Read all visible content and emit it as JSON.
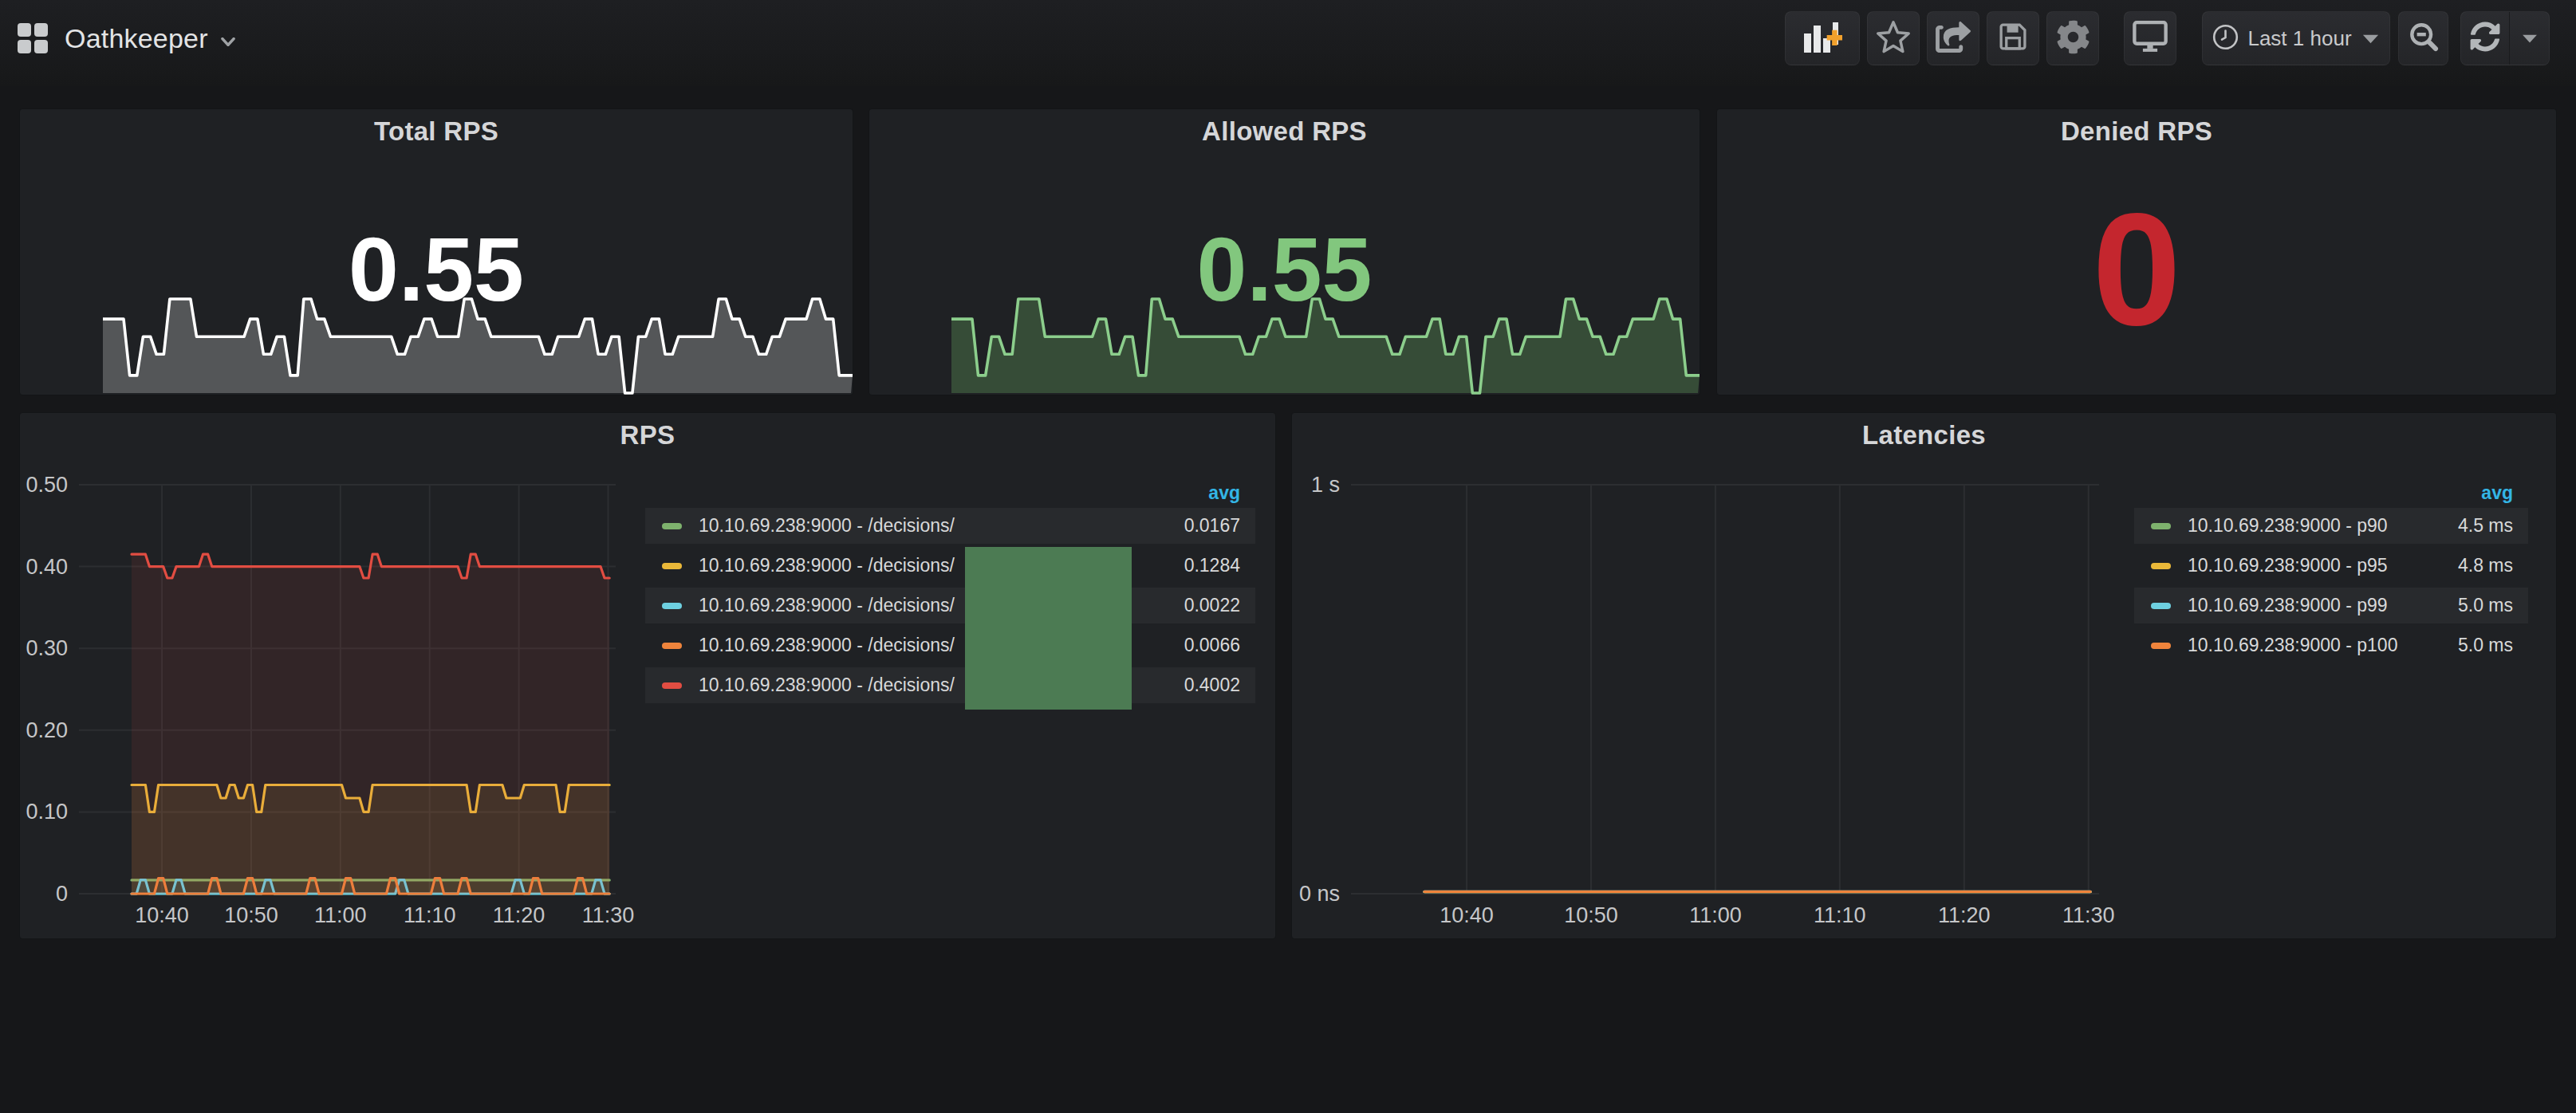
{
  "navbar": {
    "dashboard_title": "Oathkeeper",
    "buttons": {
      "add_panel": "Add panel",
      "star": "Mark as favorite",
      "share": "Share dashboard",
      "save": "Save dashboard",
      "settings": "Dashboard settings",
      "tv_mode": "Cycle view mode",
      "time_range": "Last 1 hour",
      "zoom_out": "Zoom out time range",
      "refresh": "Refresh dashboard"
    }
  },
  "colors": {
    "page_bg": "#161719",
    "panel_bg": "#1f2124",
    "green": "#7EB26D",
    "yellow": "#EAB839",
    "cyan": "#6ED0E0",
    "orange": "#EF843C",
    "red": "#E24D42",
    "stat_white": "#ffffff",
    "stat_green": "#82c77e",
    "stat_red": "#c4262e",
    "legend_header_blue": "#33b5e5",
    "grid_line": "#303236",
    "tick_text": "#c5c6c8",
    "artifact_green": "#4c7b53"
  },
  "panels": {
    "total_rps": {
      "title": "Total RPS",
      "value": "0.55"
    },
    "allowed_rps": {
      "title": "Allowed RPS",
      "value": "0.55"
    },
    "denied_rps": {
      "title": "Denied RPS",
      "value": "0"
    },
    "rps": {
      "title": "RPS",
      "legend_header": "avg",
      "legend": {
        "rows": [
          {
            "label": "10.10.69.238:9000 - /decisions/",
            "avg": "0.0167"
          },
          {
            "label": "10.10.69.238:9000 - /decisions/",
            "avg": "0.1284"
          },
          {
            "label": "10.10.69.238:9000 - /decisions/",
            "avg": "0.0022"
          },
          {
            "label": "10.10.69.238:9000 - /decisions/",
            "avg": "0.0066"
          },
          {
            "label": "10.10.69.238:9000 - /decisions/",
            "avg": "0.4002"
          }
        ]
      }
    },
    "latencies": {
      "title": "Latencies",
      "legend_header": "avg",
      "legend": {
        "rows": [
          {
            "label": "10.10.69.238:9000 - p90",
            "avg": "4.5 ms"
          },
          {
            "label": "10.10.69.238:9000 - p95",
            "avg": "4.8 ms"
          },
          {
            "label": "10.10.69.238:9000 - p99",
            "avg": "5.0 ms"
          },
          {
            "label": "10.10.69.238:9000 - p100",
            "avg": "5.0 ms"
          }
        ]
      }
    }
  },
  "chart_data": [
    {
      "id": "total_rps_sparkline",
      "type": "area",
      "title": "Total RPS",
      "current_value": 0.55,
      "note": "singlestat sparkline, last ~56 minutes, min-max scaled",
      "line_color": "#ffffff",
      "fill_color": "rgba(255,255,255,0.24)",
      "values": [
        0.565,
        0.565,
        0.517,
        0.55,
        0.535,
        0.582,
        0.582,
        0.55,
        0.55,
        0.55,
        0.55,
        0.565,
        0.535,
        0.55,
        0.517,
        0.582,
        0.565,
        0.55,
        0.55,
        0.55,
        0.55,
        0.55,
        0.535,
        0.55,
        0.565,
        0.55,
        0.55,
        0.582,
        0.565,
        0.55,
        0.55,
        0.55,
        0.55,
        0.535,
        0.55,
        0.55,
        0.565,
        0.535,
        0.55,
        0.502,
        0.55,
        0.565,
        0.535,
        0.55,
        0.55,
        0.55,
        0.582,
        0.565,
        0.55,
        0.535,
        0.55,
        0.565,
        0.565,
        0.582,
        0.565,
        0.517
      ]
    },
    {
      "id": "allowed_rps_sparkline",
      "type": "area",
      "title": "Allowed RPS",
      "current_value": 0.55,
      "note": "singlestat sparkline, identical shape to Total RPS",
      "line_color": "#8cce8c",
      "fill_color": "rgba(115,191,105,0.28)",
      "values": [
        0.565,
        0.565,
        0.517,
        0.55,
        0.535,
        0.582,
        0.582,
        0.55,
        0.55,
        0.55,
        0.55,
        0.565,
        0.535,
        0.55,
        0.517,
        0.582,
        0.565,
        0.55,
        0.55,
        0.55,
        0.55,
        0.55,
        0.535,
        0.55,
        0.565,
        0.55,
        0.55,
        0.582,
        0.565,
        0.55,
        0.55,
        0.55,
        0.55,
        0.535,
        0.55,
        0.55,
        0.565,
        0.535,
        0.55,
        0.502,
        0.55,
        0.565,
        0.535,
        0.55,
        0.55,
        0.55,
        0.582,
        0.565,
        0.55,
        0.535,
        0.55,
        0.565,
        0.565,
        0.582,
        0.565,
        0.517
      ]
    },
    {
      "id": "denied_rps",
      "type": "stat",
      "title": "Denied RPS",
      "current_value": 0
    },
    {
      "id": "rps",
      "type": "line",
      "title": "RPS",
      "xlabel": "",
      "ylabel": "",
      "ylim": [
        0,
        0.5
      ],
      "y_ticks": [
        {
          "v": 0.5,
          "label": "0.50"
        },
        {
          "v": 0.4,
          "label": "0.40"
        },
        {
          "v": 0.3,
          "label": "0.30"
        },
        {
          "v": 0.2,
          "label": "0.20"
        },
        {
          "v": 0.1,
          "label": "0.10"
        },
        {
          "v": 0.0,
          "label": "0"
        }
      ],
      "x_ticks": [
        {
          "min": 9.3,
          "label": "10:40"
        },
        {
          "min": 19.3,
          "label": "10:50"
        },
        {
          "min": 29.3,
          "label": "11:00"
        },
        {
          "min": 39.3,
          "label": "11:10"
        },
        {
          "min": 49.3,
          "label": "11:20"
        },
        {
          "min": 59.3,
          "label": "11:30"
        }
      ],
      "x_domain_min": [
        0,
        60.15
      ],
      "data_start_min": 5.9,
      "step_min": 1,
      "grid": true,
      "legend_position": "right-table",
      "series": [
        {
          "name": "10.10.69.238:9000 - /decisions/",
          "color": "#7EB26D",
          "avg": 0.0167,
          "values": [
            0.0167,
            0.0167,
            0.0167,
            0.0167,
            0.0167,
            0.0167,
            0.0167,
            0.0167,
            0.0167,
            0.0167,
            0.0167,
            0.0167,
            0.0167,
            0.0167,
            0.0167,
            0.0167,
            0.0167,
            0.0167,
            0.0167,
            0.0167,
            0.0167,
            0.0167,
            0.0167,
            0.0167,
            0.0167,
            0.0167,
            0.0167,
            0.0167,
            0.0167,
            0.0167,
            0.0167,
            0.0167,
            0.0167,
            0.0167,
            0.0167,
            0.0167,
            0.0167,
            0.0167,
            0.0167,
            0.0167,
            0.0167,
            0.0167,
            0.0167,
            0.0167,
            0.0167,
            0.0167,
            0.0167,
            0.0167,
            0.0167,
            0.0167,
            0.0167,
            0.0167,
            0.0167,
            0.0167
          ]
        },
        {
          "name": "10.10.69.238:9000 - /decisions/",
          "color": "#EAB839",
          "avg": 0.1284,
          "values": [
            0.133,
            0.133,
            0.1,
            0.133,
            0.133,
            0.133,
            0.133,
            0.133,
            0.133,
            0.133,
            0.117,
            0.133,
            0.117,
            0.133,
            0.1,
            0.133,
            0.133,
            0.133,
            0.133,
            0.133,
            0.133,
            0.133,
            0.133,
            0.133,
            0.117,
            0.117,
            0.1,
            0.133,
            0.133,
            0.133,
            0.133,
            0.133,
            0.133,
            0.133,
            0.133,
            0.133,
            0.133,
            0.133,
            0.1,
            0.133,
            0.133,
            0.133,
            0.117,
            0.117,
            0.133,
            0.133,
            0.133,
            0.133,
            0.1,
            0.133,
            0.133,
            0.133,
            0.133,
            0.133
          ]
        },
        {
          "name": "10.10.69.238:9000 - /decisions/",
          "color": "#6ED0E0",
          "avg": 0.0022,
          "values": [
            0.0,
            0.017,
            0.0,
            0.0,
            0.0,
            0.017,
            0.0,
            0.0,
            0.0,
            0.0,
            0.0,
            0.0,
            0.0,
            0.0,
            0.0,
            0.017,
            0.0,
            0.0,
            0.0,
            0.0,
            0.0,
            0.0,
            0.0,
            0.0,
            0.0,
            0.0,
            0.0,
            0.0,
            0.0,
            0.0,
            0.017,
            0.0,
            0.0,
            0.0,
            0.0,
            0.0,
            0.0,
            0.0,
            0.0,
            0.0,
            0.0,
            0.0,
            0.0,
            0.017,
            0.0,
            0.0,
            0.0,
            0.0,
            0.0,
            0.0,
            0.0,
            0.0,
            0.017,
            0.0
          ]
        },
        {
          "name": "10.10.69.238:9000 - /decisions/",
          "color": "#EF843C",
          "avg": 0.0066,
          "values": [
            0.0,
            0.0,
            0.0,
            0.019,
            0.0,
            0.0,
            0.0,
            0.0,
            0.0,
            0.019,
            0.0,
            0.0,
            0.0,
            0.019,
            0.0,
            0.0,
            0.0,
            0.0,
            0.0,
            0.0,
            0.019,
            0.0,
            0.0,
            0.0,
            0.019,
            0.0,
            0.0,
            0.0,
            0.0,
            0.019,
            0.0,
            0.0,
            0.0,
            0.0,
            0.019,
            0.0,
            0.0,
            0.019,
            0.0,
            0.0,
            0.0,
            0.0,
            0.0,
            0.0,
            0.0,
            0.019,
            0.0,
            0.0,
            0.0,
            0.0,
            0.019,
            0.0,
            0.0,
            0.0
          ]
        },
        {
          "name": "10.10.69.238:9000 - /decisions/",
          "color": "#E24D42",
          "avg": 0.4002,
          "values": [
            0.415,
            0.415,
            0.4,
            0.4,
            0.386,
            0.4,
            0.4,
            0.4,
            0.415,
            0.4,
            0.4,
            0.4,
            0.4,
            0.4,
            0.4,
            0.4,
            0.4,
            0.4,
            0.4,
            0.4,
            0.4,
            0.4,
            0.4,
            0.4,
            0.4,
            0.4,
            0.386,
            0.415,
            0.4,
            0.4,
            0.4,
            0.4,
            0.4,
            0.4,
            0.4,
            0.4,
            0.4,
            0.386,
            0.415,
            0.4,
            0.4,
            0.4,
            0.4,
            0.4,
            0.4,
            0.4,
            0.4,
            0.4,
            0.4,
            0.4,
            0.4,
            0.4,
            0.4,
            0.386
          ]
        }
      ]
    },
    {
      "id": "latencies",
      "type": "line",
      "title": "Latencies",
      "ylim": [
        0,
        1
      ],
      "y_ticks": [
        {
          "v": 1,
          "label": "1 s"
        },
        {
          "v": 0,
          "label": "0 ns"
        }
      ],
      "x_ticks": [
        {
          "min": 9.3,
          "label": "10:40"
        },
        {
          "min": 19.3,
          "label": "10:50"
        },
        {
          "min": 29.3,
          "label": "11:00"
        },
        {
          "min": 39.3,
          "label": "11:10"
        },
        {
          "min": 49.3,
          "label": "11:20"
        },
        {
          "min": 59.3,
          "label": "11:30"
        }
      ],
      "x_domain_min": [
        0,
        60.15
      ],
      "data_start_min": 5.9,
      "step_min": 1,
      "grid": true,
      "legend_position": "right-table",
      "series": [
        {
          "name": "10.10.69.238:9000 - p90",
          "color": "#7EB26D",
          "avg_seconds": 0.0045,
          "avg": "4.5 ms",
          "constant": 0.0045
        },
        {
          "name": "10.10.69.238:9000 - p95",
          "color": "#EAB839",
          "avg_seconds": 0.0048,
          "avg": "4.8 ms",
          "constant": 0.0048
        },
        {
          "name": "10.10.69.238:9000 - p99",
          "color": "#6ED0E0",
          "avg_seconds": 0.005,
          "avg": "5.0 ms",
          "constant": 0.005
        },
        {
          "name": "10.10.69.238:9000 - p100",
          "color": "#EF843C",
          "avg_seconds": 0.005,
          "avg": "5.0 ms",
          "constant": 0.005
        }
      ]
    }
  ]
}
